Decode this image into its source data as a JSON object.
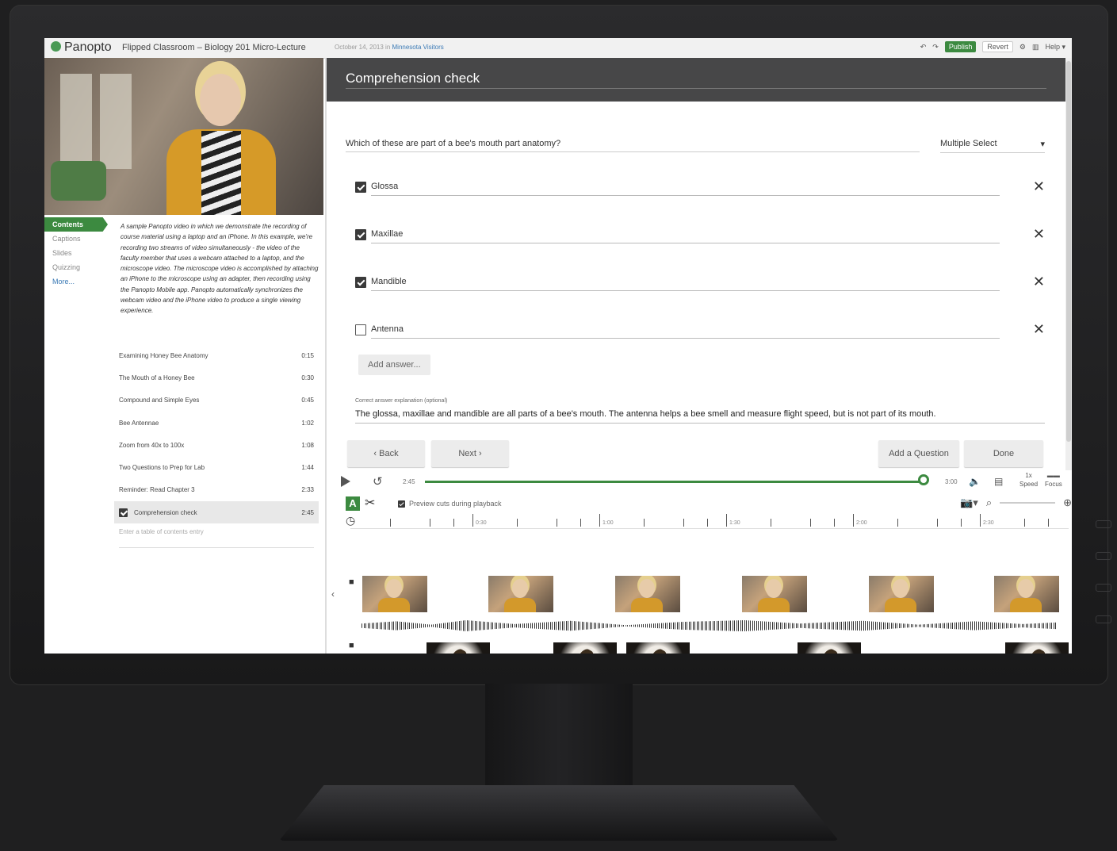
{
  "app": {
    "brand": "Panopto",
    "session_title": "Flipped Classroom – Biology 201 Micro-Lecture",
    "session_meta_prefix": "October 14, 2013 in",
    "session_meta_link": "Minnesota Visitors"
  },
  "topbar": {
    "publish_label": "Publish",
    "revert_label": "Revert",
    "help_label": "Help"
  },
  "left_nav": {
    "items": [
      "Contents",
      "Captions",
      "Slides",
      "Quizzing",
      "More..."
    ]
  },
  "description": "A sample Panopto video in which we demonstrate the recording of course material using a laptop and an iPhone. In this example, we're recording two streams of video simultaneously - the video of the faculty member that uses a webcam attached to a laptop, and the microscope video. The microscope video is accomplished by attaching an iPhone to the microscope using an adapter, then recording using the Panopto Mobile app. Panopto automatically synchronizes the webcam video and the iPhone video to produce a single viewing experience.",
  "toc": {
    "rows": [
      {
        "title": "Examining Honey Bee Anatomy",
        "time": "0:15"
      },
      {
        "title": "The Mouth of a Honey Bee",
        "time": "0:30"
      },
      {
        "title": "Compound and Simple Eyes",
        "time": "0:45"
      },
      {
        "title": "Bee Antennae",
        "time": "1:02"
      },
      {
        "title": "Zoom from 40x to 100x",
        "time": "1:08"
      },
      {
        "title": "Two Questions to Prep for Lab",
        "time": "1:44"
      },
      {
        "title": "Reminder: Read Chapter 3",
        "time": "2:33"
      },
      {
        "title": "Comprehension check",
        "time": "2:45"
      }
    ],
    "input_placeholder": "Enter a table of contents entry"
  },
  "quiz": {
    "title": "Comprehension check",
    "question": "Which of these are part of a bee's mouth part anatomy?",
    "question_type": "Multiple Select",
    "answers": [
      {
        "text": "Glossa",
        "checked": true
      },
      {
        "text": "Maxillae",
        "checked": true
      },
      {
        "text": "Mandible",
        "checked": true
      },
      {
        "text": "Antenna",
        "checked": false
      }
    ],
    "add_answer_label": "Add answer...",
    "explanation_label": "Correct answer explanation (optional)",
    "explanation": "The glossa, maxillae and mandible are all parts of a bee's mouth. The antenna helps a bee smell and measure flight speed, but is not part of its mouth.",
    "back_label": "Back",
    "next_label": "Next",
    "add_question_label": "Add a Question",
    "done_label": "Done"
  },
  "player": {
    "current_time": "2:45",
    "duration": "3:00",
    "progress": 0.98,
    "speed_label": "1x",
    "speed_caption": "Speed",
    "focus_caption": "Focus"
  },
  "editor": {
    "preview_label": "Preview cuts during playback",
    "ruler_labels": [
      "0:30",
      "1:00",
      "1:30",
      "2:00",
      "2:30"
    ]
  },
  "colors": {
    "accent": "#3c8a40",
    "header_dark": "#474748",
    "playhead": "#cc3333"
  },
  "icons": [
    "play-icon",
    "replay-icon",
    "volume-icon",
    "captions-icon",
    "text-tool-icon",
    "scissors-icon",
    "camera-icon",
    "zoom-icon",
    "clock-icon",
    "close-icon",
    "gear-icon",
    "layout-icon"
  ]
}
